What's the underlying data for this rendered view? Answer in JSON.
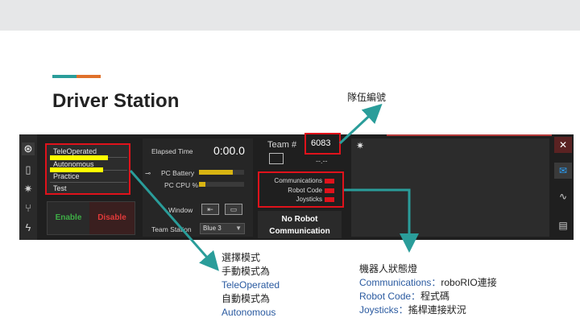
{
  "slide": {
    "title": "Driver Station"
  },
  "left_sidebar": {
    "icons": [
      "steering-wheel-icon",
      "diagnostics-icon",
      "gear-icon",
      "usb-icon",
      "power-icon"
    ]
  },
  "modes": {
    "items": [
      "TeleOperated",
      "Autonomous",
      "Practice",
      "Test"
    ],
    "highlighted": [
      "TeleOperated",
      "Autonomous"
    ]
  },
  "controls": {
    "enable": "Enable",
    "disable": "Disable"
  },
  "status": {
    "elapsed_label": "Elapsed Time",
    "elapsed_value": "0:00.0",
    "battery_label": "PC Battery",
    "battery_level": 0.75,
    "cpu_label": "PC CPU %",
    "cpu_level": 0.15,
    "window_label": "Window",
    "team_station_label": "Team Station",
    "team_station_value": "Blue 3"
  },
  "team": {
    "label": "Team #",
    "number": "6083",
    "voltage": "--.--"
  },
  "indicators": {
    "items": [
      "Communications",
      "Robot Code",
      "Joysticks"
    ],
    "color": "#e0121b"
  },
  "robot_status": {
    "line1": "No Robot",
    "line2": "Communication"
  },
  "annotations": {
    "team_note": "隊伍編號",
    "mode_note": {
      "line1": "選擇模式",
      "line2": "手動模式為",
      "line3": "TeleOperated",
      "line4": "自動模式為",
      "line5": "Autonomous"
    },
    "indicator_note": {
      "line1": "機器人狀態燈",
      "line2_a": "Communications：",
      "line2_b": "roboRIO連接",
      "line3_a": "Robot Code：",
      "line3_b": "程式碼",
      "line4_a": "Joysticks：",
      "line4_b": "搖桿連接狀況"
    }
  },
  "colors": {
    "highlight_box": "#e0121b",
    "arrow": "#2a9d9a",
    "marker": "#ffff00",
    "accent_teal": "#2a9d9a",
    "accent_orange": "#e0712b"
  }
}
